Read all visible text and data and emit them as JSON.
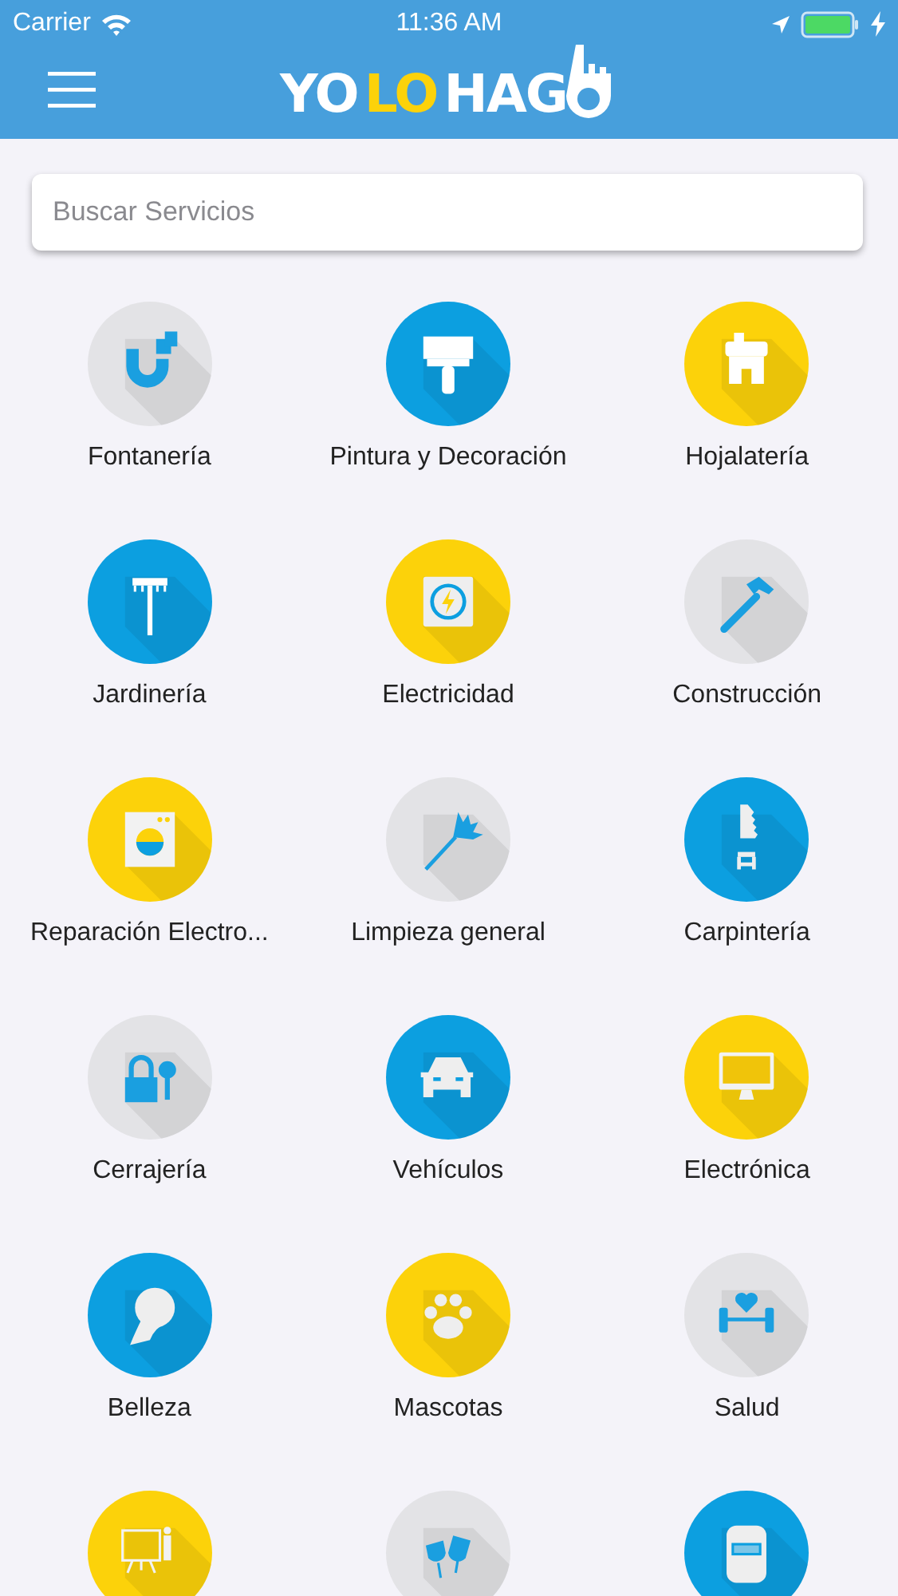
{
  "status_bar": {
    "carrier": "Carrier",
    "time": "11:36 AM"
  },
  "nav_bar": {
    "logo": [
      "YO",
      "LO",
      "HAG"
    ]
  },
  "search": {
    "placeholder": "Buscar Servicios"
  },
  "services": [
    {
      "label": "Fontanería",
      "kind": "pipe",
      "color": "#e3e3e6"
    },
    {
      "label": "Pintura y Decoración",
      "kind": "brush",
      "color": "#0c9fe0"
    },
    {
      "label": "Hojalatería",
      "kind": "house",
      "color": "#fcd20a"
    },
    {
      "label": "Jardinería",
      "kind": "rake",
      "color": "#0c9fe0"
    },
    {
      "label": "Electricidad",
      "kind": "power",
      "color": "#fcd20a"
    },
    {
      "label": "Construcción",
      "kind": "hammer",
      "color": "#e3e3e6"
    },
    {
      "label": "Reparación Electro...",
      "kind": "washer",
      "color": "#fcd20a"
    },
    {
      "label": "Limpieza general",
      "kind": "duster",
      "color": "#e3e3e6"
    },
    {
      "label": "Carpintería",
      "kind": "saw",
      "color": "#0c9fe0"
    },
    {
      "label": "Cerrajería",
      "kind": "lock",
      "color": "#e3e3e6"
    },
    {
      "label": "Vehículos",
      "kind": "car",
      "color": "#0c9fe0"
    },
    {
      "label": "Electrónica",
      "kind": "monitor",
      "color": "#fcd20a"
    },
    {
      "label": "Belleza",
      "kind": "head",
      "color": "#0c9fe0"
    },
    {
      "label": "Mascotas",
      "kind": "paw",
      "color": "#fcd20a"
    },
    {
      "label": "Salud",
      "kind": "dumbbell",
      "color": "#e3e3e6"
    },
    {
      "kind": "teacher",
      "color": "#fcd20a"
    },
    {
      "kind": "glasses",
      "color": "#e3e3e6"
    },
    {
      "kind": "mask",
      "color": "#0c9fe0"
    }
  ]
}
